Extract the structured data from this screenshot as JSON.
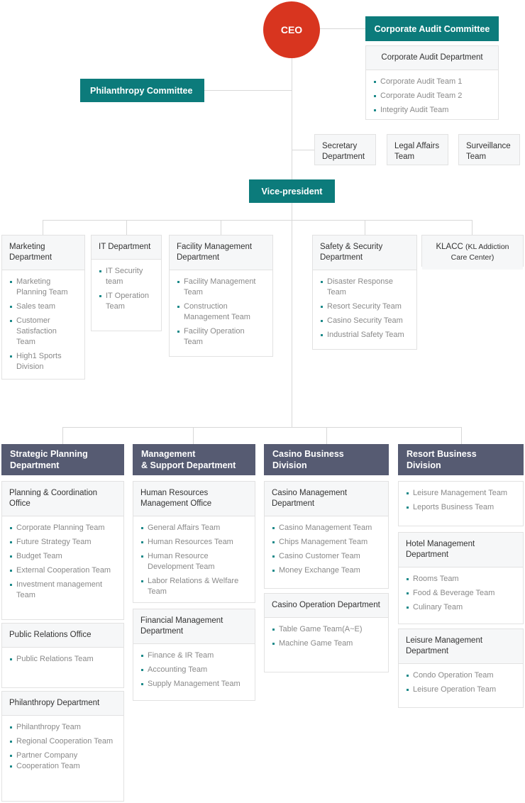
{
  "colors": {
    "accent_teal": "#0c7b7b",
    "ceo_red": "#d8351f",
    "division_header": "#565b72",
    "box_header_bg": "#f6f7f8",
    "line": "#d8d8d8",
    "bullet": "#1d8a8a"
  },
  "top": {
    "ceo": "CEO",
    "philanthropy_committee": "Philanthropy Committee",
    "corporate_audit_committee": "Corporate Audit Committee",
    "corporate_audit_department": {
      "title": "Corporate Audit Department",
      "items": [
        "Corporate Audit Team 1",
        "Corporate Audit Team 2",
        "Integrity Audit Team"
      ]
    },
    "staff_boxes": [
      {
        "line1": "Secretary",
        "line2": "Department"
      },
      {
        "line1": "Legal Affairs",
        "line2": "Team"
      },
      {
        "line1": "Surveillance",
        "line2": "Team"
      }
    ],
    "vice_president": "Vice-president"
  },
  "departments": [
    {
      "title_line1": "Marketing",
      "title_line2": "Department",
      "items": [
        "Marketing Planning Team",
        "Sales team",
        "Customer Satisfaction Team",
        "High1 Sports Division"
      ]
    },
    {
      "title_line1": "IT",
      "title_line2": "Department",
      "items": [
        "IT Security team",
        "IT Operation Team"
      ]
    },
    {
      "title_line1": "Facility Management",
      "title_line2": "Department",
      "items": [
        "Facility Management Team",
        "Construction Management Team",
        "Facility Operation Team"
      ]
    },
    {
      "title_line1": "Safety & Security",
      "title_line2": "Department",
      "items": [
        "Disaster Response Team",
        "Resort Security Team",
        "Casino Security Team",
        "Industrial Safety Team"
      ]
    },
    {
      "title_line1": "KLACC",
      "title_line2": "(KL Addiction  Care Center)",
      "items": []
    }
  ],
  "divisions": [
    {
      "name_line1": "Strategic Planning",
      "name_line2": "Department",
      "direct_items": [],
      "sub": [
        {
          "title_line1": "Planning",
          "title_line2": "& Coordination Office",
          "items": [
            "Corporate Planning Team",
            "Future Strategy Team",
            "Budget Team",
            "External Cooperation Team",
            "Investment management Team"
          ]
        },
        {
          "title_line1": "Public Relations",
          "title_line2": "Office",
          "items": [
            "Public Relations Team"
          ]
        },
        {
          "title_line1": "Philanthropy",
          "title_line2": "Department",
          "items": [
            "Philanthropy Team",
            "Regional Cooperation Team",
            "Partner Company",
            "Cooperation Team"
          ]
        }
      ]
    },
    {
      "name_line1": "Management",
      "name_line2": "& Support Department",
      "direct_items": [],
      "sub": [
        {
          "title_line1": "Human Resources",
          "title_line2": "Management Office",
          "items": [
            "General Affairs Team",
            "Human Resources Team",
            "Human Resource Development Team",
            "Labor Relations & Welfare Team"
          ]
        },
        {
          "title_line1": "Financial Management",
          "title_line2": "Department",
          "items": [
            "Finance & IR Team",
            "Accounting Team",
            "Supply Management Team"
          ]
        }
      ]
    },
    {
      "name_line1": "Casino Business",
      "name_line2": "Division",
      "direct_items": [],
      "sub": [
        {
          "title_line1": "Casino Management",
          "title_line2": "Department",
          "items": [
            "Casino Management Team",
            "Chips Management Team",
            "Casino Customer Team",
            "Money Exchange Team"
          ]
        },
        {
          "title_line1": "Casino Operation",
          "title_line2": "Department",
          "items": [
            "Table Game Team(A~E)",
            "Machine Game Team"
          ]
        }
      ]
    },
    {
      "name_line1": "Resort Business",
      "name_line2": "Division",
      "direct_items": [
        "Leisure Management Team",
        "Leports Business Team"
      ],
      "sub": [
        {
          "title_line1": "Hotel Management",
          "title_line2": "Department",
          "items": [
            "Rooms Team",
            "Food & Beverage Team",
            "Culinary Team"
          ]
        },
        {
          "title_line1": "Leisure Management",
          "title_line2": "Department",
          "items": [
            "Condo Operation Team",
            "Leisure Operation Team"
          ]
        }
      ]
    }
  ]
}
